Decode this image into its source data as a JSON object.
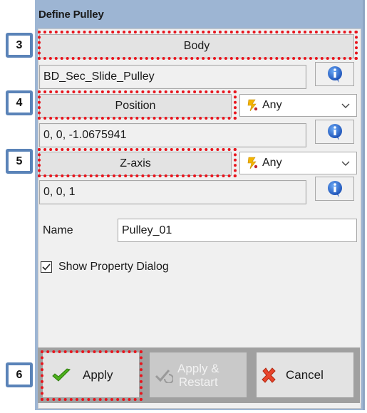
{
  "window": {
    "title": "Define Pulley"
  },
  "body_section": {
    "button_label": "Body",
    "value": "BD_Sec_Slide_Pulley"
  },
  "position_section": {
    "button_label": "Position",
    "filter": "Any",
    "value": "0,  0,  -1.0675941"
  },
  "zaxis_section": {
    "button_label": "Z-axis",
    "filter": "Any",
    "value": "0, 0, 1"
  },
  "name_field": {
    "label": "Name",
    "value": "Pulley_01"
  },
  "show_property": {
    "label": "Show Property Dialog",
    "checked": true
  },
  "footer": {
    "apply_label": "Apply",
    "apply_restart_line1": "Apply &",
    "apply_restart_line2": "Restart",
    "cancel_label": "Cancel"
  },
  "annotations": [
    "3",
    "4",
    "5",
    "6"
  ],
  "colors": {
    "highlight": "#e8141c",
    "badge_border": "#5a83b8",
    "title_bar": "#9db5d3"
  }
}
